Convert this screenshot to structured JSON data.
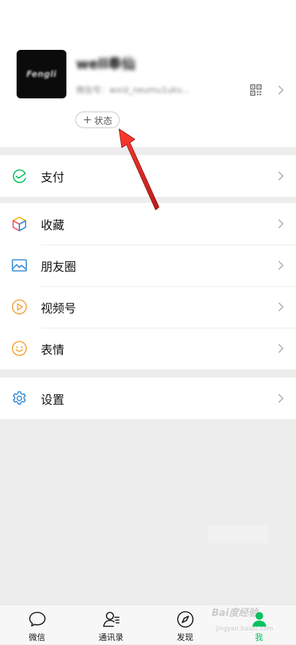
{
  "profile": {
    "avatar_text": "Fengli",
    "nickname": "well奉仙",
    "wxid": "微信号：wxid_neumu1ukv...",
    "status_button_label": "状态"
  },
  "menu": {
    "pay": {
      "label": "支付",
      "icon": "pay-icon",
      "color": "#07c160"
    },
    "favorites": {
      "label": "收藏",
      "icon": "favorites-cube-icon"
    },
    "moments": {
      "label": "朋友圈",
      "icon": "moments-image-icon",
      "color": "#2e87d6"
    },
    "channels": {
      "label": "视频号",
      "icon": "channels-play-icon",
      "color": "#f0a336"
    },
    "stickers": {
      "label": "表情",
      "icon": "sticker-smile-icon",
      "color": "#f0a336"
    },
    "settings": {
      "label": "设置",
      "icon": "settings-gear-icon",
      "color": "#2e87d6"
    }
  },
  "tabbar": {
    "chats": {
      "label": "微信",
      "icon": "chat-bubble-icon"
    },
    "contacts": {
      "label": "通讯录",
      "icon": "contacts-icon"
    },
    "discover": {
      "label": "发现",
      "icon": "compass-icon"
    },
    "me": {
      "label": "我",
      "icon": "person-icon",
      "active": true,
      "color": "#07c160"
    }
  },
  "watermark": {
    "text": "Bai度经验",
    "sub": "jingyan.baidu.com"
  },
  "colors": {
    "accent": "#07c160",
    "background": "#ededed",
    "annotation_arrow": "#e02020"
  }
}
